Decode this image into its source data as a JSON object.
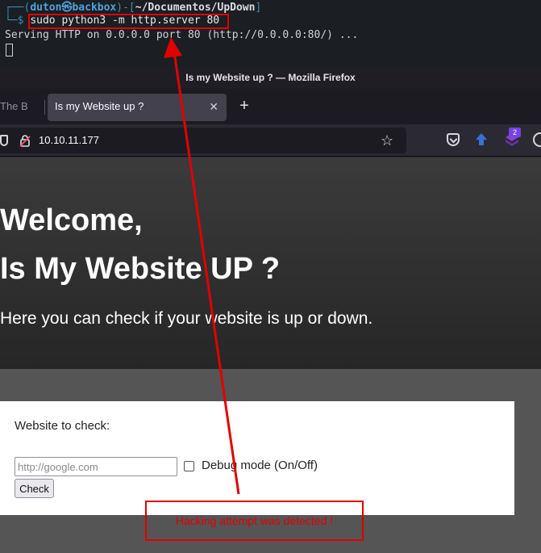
{
  "terminal": {
    "prompt_prefix": "┌──(",
    "user": "duton",
    "at_symbol": "㉿",
    "host": "backbox",
    "sep": ")-[",
    "cwd": "~/Documentos/UpDown",
    "close": "]",
    "prompt_symbol": "└─$ ",
    "command": "sudo python3 -m http.server 80",
    "output": "Serving HTTP on 0.0.0.0 port 80 (http://0.0.0.0:80/) ..."
  },
  "browser": {
    "window_title": "Is my Website up ? — Mozilla Firefox",
    "tabs": [
      {
        "label": "The B"
      },
      {
        "label": "Is my Website up ?"
      }
    ],
    "new_tab_label": "+",
    "url": "10.10.11.177",
    "extension_badge": "2",
    "accent_color": "#7542e5"
  },
  "page": {
    "heading_line1": "Welcome,",
    "heading_line2": "Is My Website UP ?",
    "subtitle": "Here you can check if your website is up or down.",
    "form": {
      "label": "Website to check:",
      "input_placeholder": "http://google.com",
      "input_value": "",
      "debug_label": "Debug mode (On/Off)",
      "debug_checked": false,
      "button_label": "Check"
    },
    "alert": "Hacking attempt was detected !"
  },
  "annotation": {
    "color": "#e10000"
  }
}
